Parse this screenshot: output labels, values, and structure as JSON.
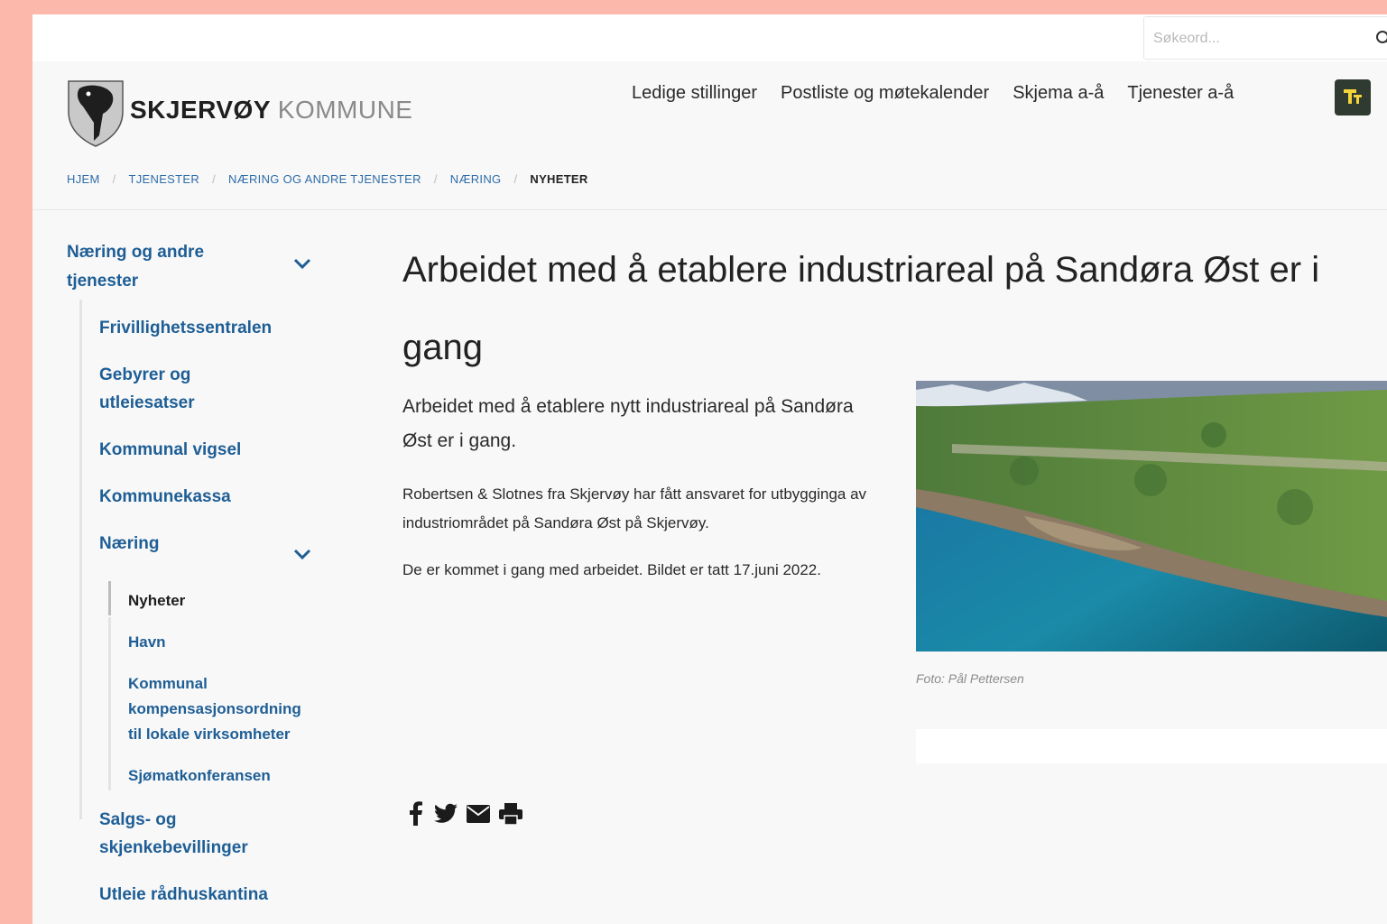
{
  "search": {
    "placeholder": "Søkeord..."
  },
  "header": {
    "brand_main": "SKJERVØY",
    "brand_sub": "KOMMUNE"
  },
  "nav": {
    "items": [
      "Ledige stillinger",
      "Postliste og møtekalender",
      "Skjema a-å",
      "Tjenester a-å"
    ]
  },
  "breadcrumb": {
    "items": [
      "HJEM",
      "TJENESTER",
      "NÆRING OG ANDRE TJENESTER",
      "NÆRING",
      "NYHETER"
    ]
  },
  "sidebar": {
    "parent_line1": "Næring og andre",
    "parent_line2": "tjenester",
    "items": [
      "Frivillighetssentralen",
      "Gebyrer og",
      "utleiesatser",
      "Kommunal vigsel",
      "Kommunekassa",
      "Næring",
      "Nyheter",
      "Havn",
      "Kommunal",
      "kompensasjonsordning",
      "til lokale virksomheter",
      "Sjømatkonferansen",
      "Salgs- og",
      "skjenkebevillinger",
      "Utleie rådhuskantina"
    ]
  },
  "article": {
    "title": "Arbeidet med å etablere industriareal på Sandøra Øst er i gang",
    "lead": "Arbeidet med å etablere nytt industriareal på Sandøra Øst er i gang.",
    "p1": "Robertsen & Slotnes fra Skjervøy har fått ansvaret for utbygginga av industriområdet på Sandøra Øst på Skjervøy.",
    "p2": "De er kommet i gang med arbeidet. Bildet er tatt 17.juni 2022.",
    "caption": "Foto: Pål Pettersen"
  },
  "share": {
    "icons": [
      "facebook-icon",
      "twitter-icon",
      "email-icon",
      "print-icon"
    ]
  },
  "colors": {
    "accent": "#1e5e95",
    "background": "#fbb8ab",
    "toggle": "#2f3a31",
    "toggle_icon": "#f2d43b"
  }
}
